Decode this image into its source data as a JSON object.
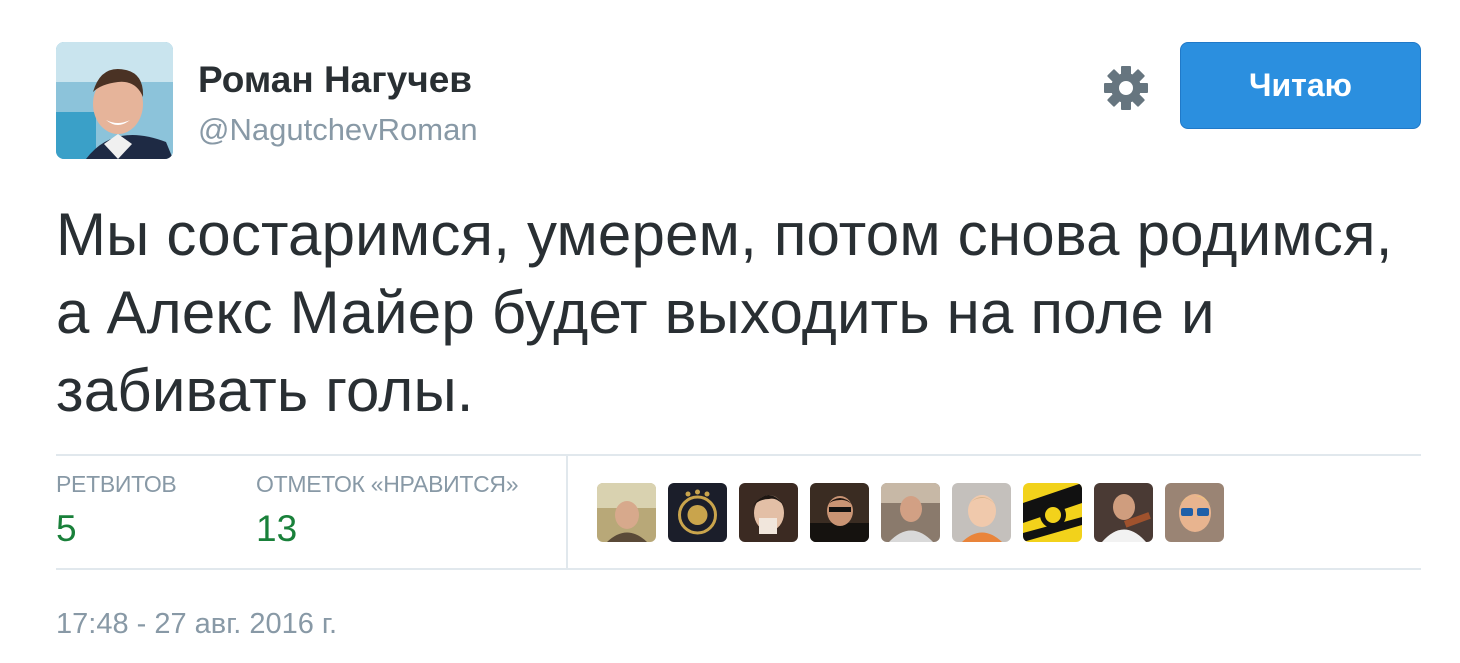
{
  "author": {
    "display_name": "Роман Нагучев",
    "handle": "@NagutchevRoman"
  },
  "header": {
    "settings_icon": "gear-icon",
    "follow_label": "Читаю",
    "accent_color": "#2b8fdf"
  },
  "tweet": {
    "text": "Мы состаримся, умерем, потом снова родимся, а Алекс Майер будет выходить на поле и забивать голы."
  },
  "stats": {
    "retweets_label": "РЕТВИТОВ",
    "retweets_value": "5",
    "likes_label": "ОТМЕТОК «НРАВИТСЯ»",
    "likes_value": "13",
    "value_color": "#19803a"
  },
  "likers": {
    "count_shown": 9
  },
  "footer": {
    "timestamp": "17:48 - 27 авг. 2016 г."
  }
}
